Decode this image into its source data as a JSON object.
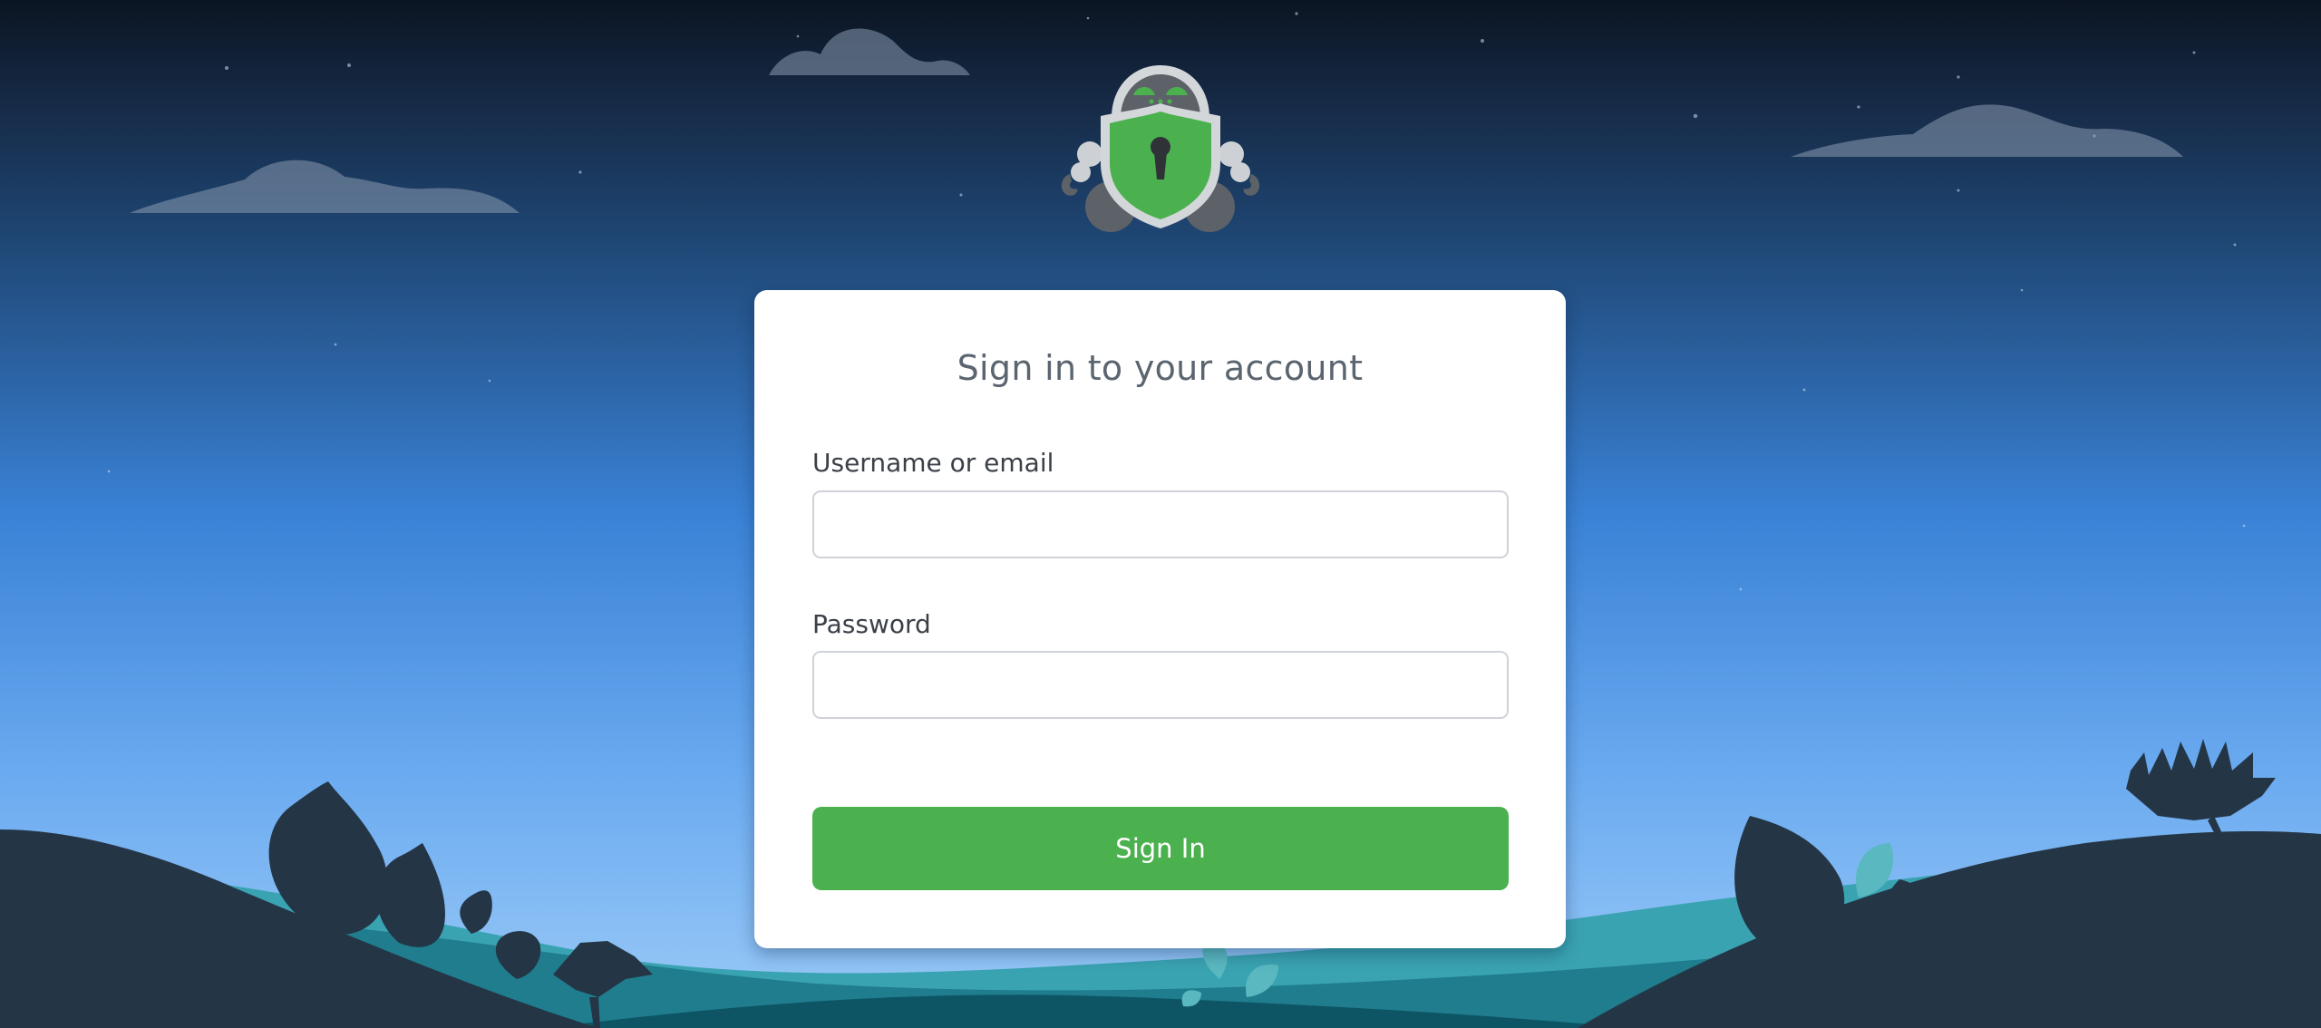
{
  "page": {
    "title": "Sign in to your account"
  },
  "logo": {
    "icon": "robot-shield-keyhole-logo"
  },
  "form": {
    "username_label": "Username or email",
    "username_value": "",
    "password_label": "Password",
    "password_value": "",
    "submit_label": "Sign In"
  },
  "colors": {
    "accent": "#4bb14f",
    "card_background": "#ffffff",
    "title_text": "#5b6570",
    "label_text": "#3b4048",
    "input_border": "#cfd3d8"
  }
}
